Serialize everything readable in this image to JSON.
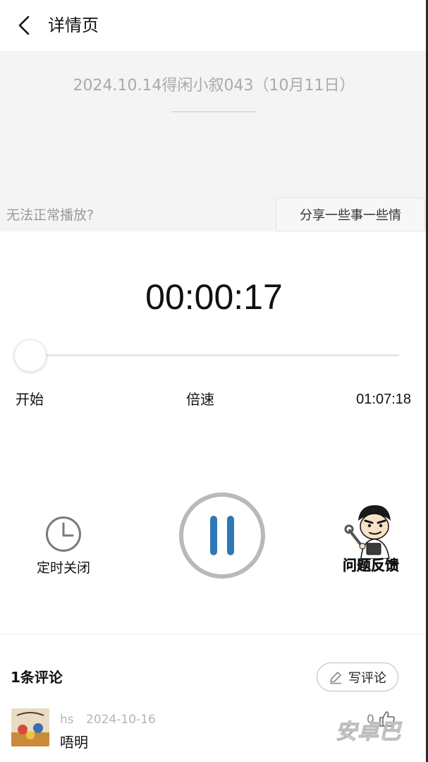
{
  "header": {
    "title": "详情页"
  },
  "episode": {
    "title": "2024.10.14得闲小叙043（10月11日）"
  },
  "playback_issue": {
    "text": "无法正常播放?"
  },
  "share": {
    "label": "分享一些事一些情"
  },
  "player": {
    "current_time": "00:00:17",
    "start_label": "开始",
    "speed_label": "倍速",
    "duration": "01:07:18",
    "progress_percent": 0.4,
    "accent_color": "#2f78b7"
  },
  "controls": {
    "sleep_timer_label": "定时关闭",
    "feedback_label": "问题反馈",
    "icons": [
      "clock-icon",
      "pause-icon",
      "feedback-mascot-icon"
    ]
  },
  "comments": {
    "count_label": "1条评论",
    "write_label": "写评论",
    "items": [
      {
        "user": "hs",
        "date": "2024-10-16",
        "text": "唔明",
        "likes": "0"
      }
    ]
  }
}
